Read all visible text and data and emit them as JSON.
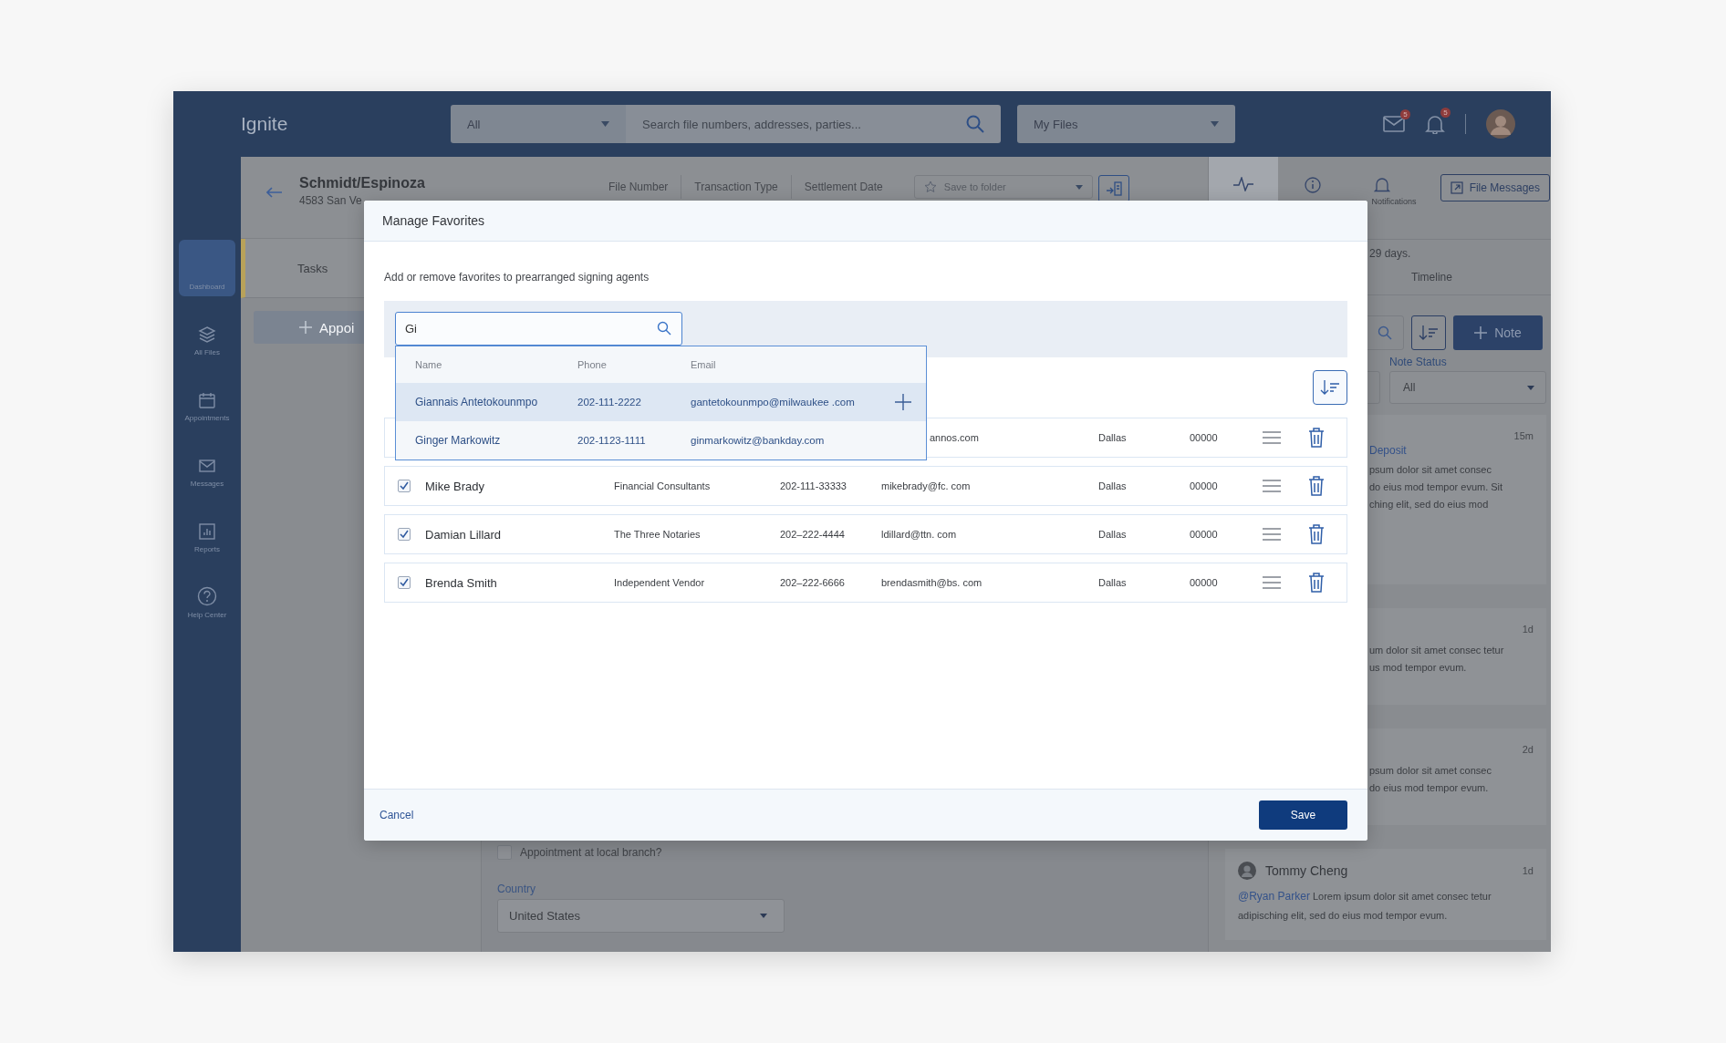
{
  "top_bar": {
    "logo": "Ignite",
    "scope": "All",
    "search_placeholder": "Search file numbers, addresses, parties...",
    "files_filter": "My Files",
    "mail_badge": "5",
    "bell_badge": "5"
  },
  "sidebar": {
    "items": [
      {
        "label": "Dashboard",
        "selected": true
      },
      {
        "label": "All Files",
        "selected": false
      },
      {
        "label": "Appointments",
        "selected": false
      },
      {
        "label": "Messages",
        "selected": false
      },
      {
        "label": "Reports",
        "selected": false
      },
      {
        "label": "Help Center",
        "selected": false
      }
    ]
  },
  "file_header": {
    "title": "Schmidt/Espinoza",
    "address": "4583 San Ve",
    "fields": [
      "File Number",
      "Transaction Type",
      "Settlement Date"
    ],
    "save_to_folder": "Save to folder"
  },
  "left_tabs": [
    {
      "label": "Tasks",
      "selected": true
    }
  ],
  "appointment_button": "Appoi",
  "form": {
    "local_branch": {
      "label": "Appointment at local branch?",
      "checked": false
    },
    "country": {
      "label": "Country",
      "value": "United States"
    }
  },
  "right_panel": {
    "tabs": [
      {
        "selected": true
      },
      {
        "selected": false
      },
      {
        "label": "Notifications",
        "selected": false
      }
    ],
    "file_messages": "File Messages",
    "notice": "29 days.",
    "timeline_tab": "Timeline",
    "note_button": "Note",
    "note_status": {
      "label": "Note Status",
      "value": "All"
    },
    "notes": [
      {
        "time": "15m",
        "link": "Deposit",
        "lines": [
          "psum dolor sit amet consec",
          "do eius mod tempor evum. Sit",
          "ching elit, sed do eius mod"
        ]
      },
      {
        "time": "1d",
        "lines": [
          "um dolor sit amet consec tetur",
          "us mod tempor evum."
        ]
      },
      {
        "time": "2d",
        "lines": [
          "psum dolor sit amet consec",
          "do eius mod tempor evum."
        ]
      },
      {
        "author": "Tommy Cheng",
        "time": "1d",
        "mention": "@Ryan Parker",
        "text": "Lorem ipsum dolor sit amet consec tetur adipisching elit, sed do eius mod tempor evum."
      }
    ]
  },
  "modal": {
    "title": "Manage Favorites",
    "description": "Add or remove favorites to prearranged signing agents",
    "search": {
      "value": "Gi"
    },
    "suggestions": {
      "columns": [
        "Name",
        "Phone",
        "Email"
      ],
      "rows": [
        {
          "name": "Giannais Antetokounmpo",
          "phone": "202-111-2222",
          "email": "gantetokounmpo@milwaukee .com",
          "selected": true
        },
        {
          "name": "Ginger Markowitz",
          "phone": "202-1123-1111",
          "email": "ginmarkowitz@bankday.com",
          "selected": false
        }
      ]
    },
    "favorites": [
      {
        "email": "annos.com",
        "city": "Dallas",
        "zip": "00000"
      },
      {
        "checked": true,
        "name": "Mike Brady",
        "company": "Financial Consultants",
        "phone": "202-111-33333",
        "email": "mikebrady@fc. com",
        "city": "Dallas",
        "zip": "00000"
      },
      {
        "checked": true,
        "name": "Damian Lillard",
        "company": "The Three Notaries",
        "phone": "202–222-4444",
        "email": "ldillard@ttn. com",
        "city": "Dallas",
        "zip": "00000"
      },
      {
        "checked": true,
        "name": "Brenda Smith",
        "company": "Independent Vendor",
        "phone": "202–222-6666",
        "email": "brendasmith@bs. com",
        "city": "Dallas",
        "zip": "00000"
      }
    ],
    "cancel": "Cancel",
    "save": "Save"
  }
}
